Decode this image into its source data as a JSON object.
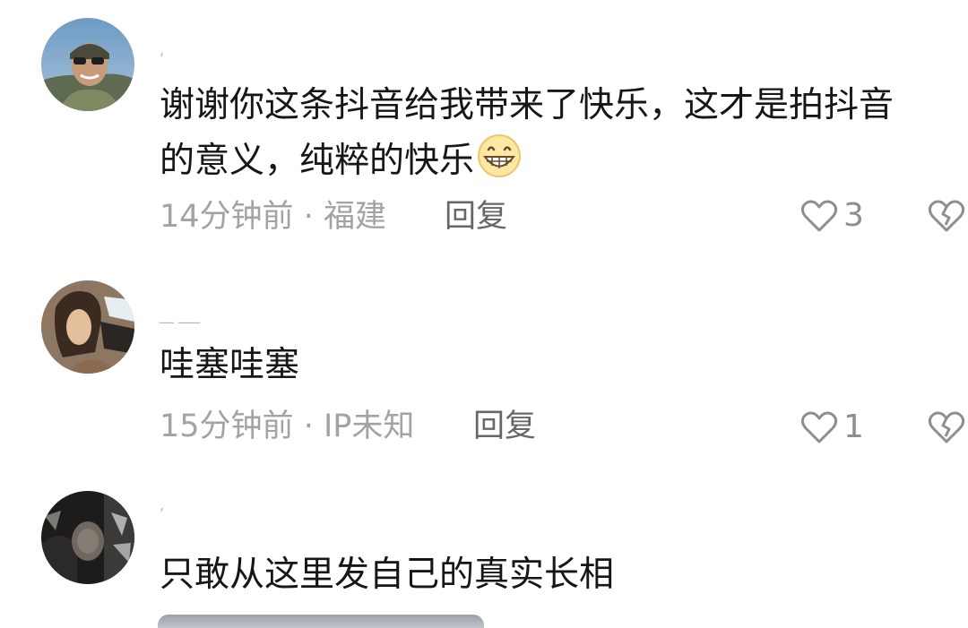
{
  "comments": [
    {
      "username": ",",
      "text_line1": "谢谢你这条抖音给我带来了快乐，这才是拍抖音",
      "text_line2": "的意义，纯粹的快乐",
      "emoji_icon": "grinning-face-icon",
      "time": "14分钟前",
      "separator": "·",
      "location": "福建",
      "reply_label": "回复",
      "like_count": "3"
    },
    {
      "username": "__ ___",
      "text_line1": "哇塞哇塞",
      "time": "15分钟前",
      "separator": "·",
      "location": "IP未知",
      "reply_label": "回复",
      "like_count": "1"
    },
    {
      "username": ",",
      "text_line1": "只敢从这里发自己的真实长相"
    }
  ],
  "icons": {
    "like": "heart-icon",
    "dislike": "broken-heart-icon"
  },
  "colors": {
    "text_primary": "#161616",
    "meta_text": "#a3a3a3",
    "reply_text": "#676767",
    "icon_gray": "#8e8e8e"
  }
}
